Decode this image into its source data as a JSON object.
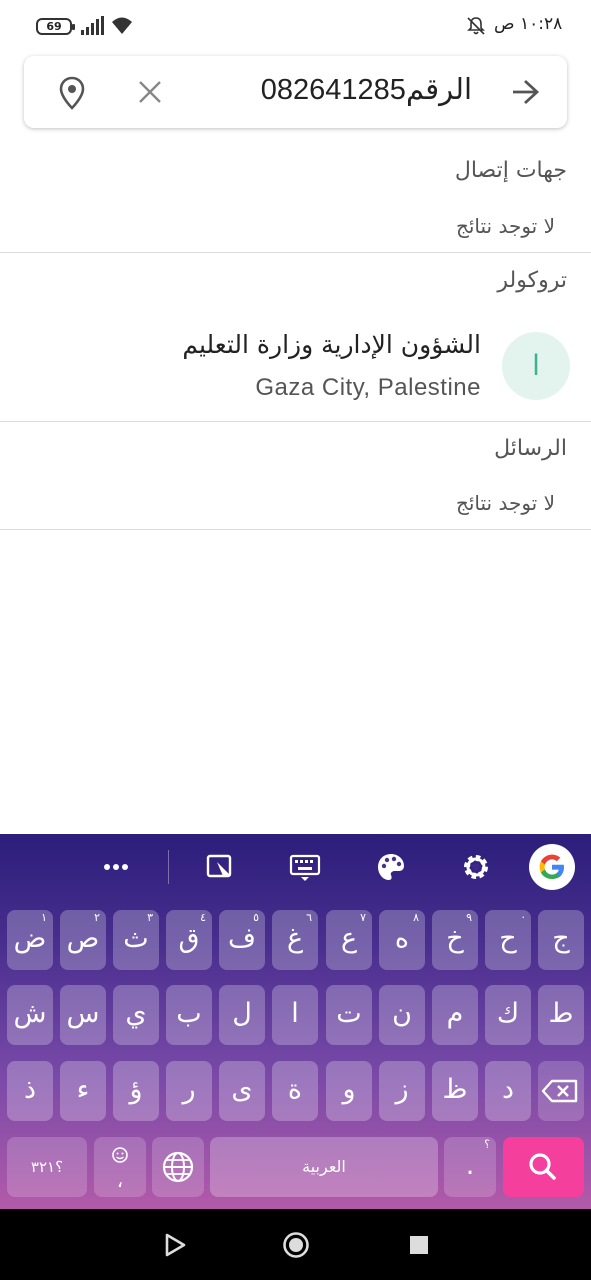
{
  "status_bar": {
    "time": "١٠:٢٨ ص",
    "battery": "69",
    "icons": [
      "battery-icon",
      "signal-icon",
      "wifi-icon",
      "notifications-muted-icon"
    ]
  },
  "search": {
    "value": "الرقم082641285",
    "icons": [
      "location-pin-icon",
      "clear-icon",
      "arrow-forward-icon"
    ]
  },
  "sections": {
    "contacts": {
      "title": "جهات إتصال",
      "empty": "لا توجد نتائج"
    },
    "truecaller": {
      "title": "تروكولر",
      "results": [
        {
          "avatar_letter": "ا",
          "name": "الشؤون الإدارية وزارة التعليم",
          "location": "Gaza City, Palestine"
        }
      ]
    },
    "messages": {
      "title": "الرسائل",
      "empty": "لا توجد نتائج"
    }
  },
  "keyboard": {
    "toolbar_icons": [
      "google-icon",
      "settings-icon",
      "theme-palette-icon",
      "keyboard-icon",
      "floating-keyboard-icon",
      "more-options-icon"
    ],
    "rows": [
      [
        {
          "label": "ج",
          "hint": ""
        },
        {
          "label": "ح",
          "hint": "·"
        },
        {
          "label": "خ",
          "hint": "٩"
        },
        {
          "label": "ه",
          "hint": "٨"
        },
        {
          "label": "ع",
          "hint": "٧"
        },
        {
          "label": "غ",
          "hint": "٦"
        },
        {
          "label": "ف",
          "hint": "٥"
        },
        {
          "label": "ق",
          "hint": "٤"
        },
        {
          "label": "ث",
          "hint": "٣"
        },
        {
          "label": "ص",
          "hint": "٢"
        },
        {
          "label": "ض",
          "hint": "١"
        }
      ],
      [
        {
          "label": "ط",
          "hint": ""
        },
        {
          "label": "ك",
          "hint": ""
        },
        {
          "label": "م",
          "hint": ""
        },
        {
          "label": "ن",
          "hint": ""
        },
        {
          "label": "ت",
          "hint": ""
        },
        {
          "label": "ا",
          "hint": ""
        },
        {
          "label": "ل",
          "hint": ""
        },
        {
          "label": "ب",
          "hint": ""
        },
        {
          "label": "ي",
          "hint": ""
        },
        {
          "label": "س",
          "hint": ""
        },
        {
          "label": "ش",
          "hint": ""
        }
      ],
      [
        {
          "label": "د",
          "hint": ""
        },
        {
          "label": "ظ",
          "hint": ""
        },
        {
          "label": "ز",
          "hint": ""
        },
        {
          "label": "و",
          "hint": ""
        },
        {
          "label": "ة",
          "hint": ""
        },
        {
          "label": "ى",
          "hint": ""
        },
        {
          "label": "ر",
          "hint": ""
        },
        {
          "label": "ؤ",
          "hint": ""
        },
        {
          "label": "ء",
          "hint": ""
        },
        {
          "label": "ذ",
          "hint": ""
        }
      ]
    ],
    "bottom": {
      "symbols": "؟٣٢١",
      "emoji_comma": "،",
      "space": "العربية",
      "period": ".",
      "period_hint": "؟"
    },
    "colors": {
      "top": "#2b1e7a",
      "bottom": "#b25aa9",
      "search_key": "#f43f9d"
    }
  },
  "navigation_bar": {
    "icons": [
      "back-icon",
      "home-icon",
      "recents-icon"
    ]
  }
}
